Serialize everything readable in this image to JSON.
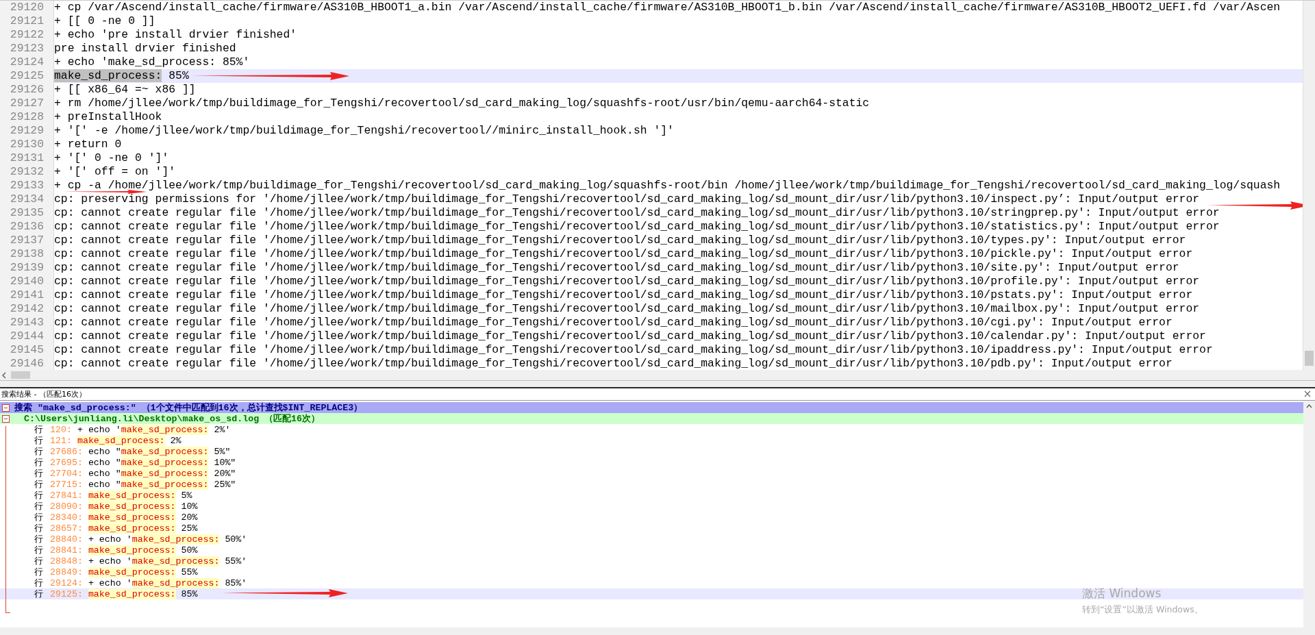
{
  "editor": {
    "lines": [
      {
        "number": "29120",
        "text": "+ cp /var/Ascend/install_cache/firmware/AS310B_HBOOT1_a.bin /var/Ascend/install_cache/firmware/AS310B_HBOOT1_b.bin /var/Ascend/install_cache/firmware/AS310B_HBOOT2_UEFI.fd /var/Ascen",
        "current": false
      },
      {
        "number": "29121",
        "text": "+ [[ 0 -ne 0 ]]",
        "current": false
      },
      {
        "number": "29122",
        "text": "+ echo 'pre install drvier finished'",
        "current": false
      },
      {
        "number": "29123",
        "text": "pre install drvier finished",
        "current": false
      },
      {
        "number": "29124",
        "text": "+ echo 'make_sd_process: 85%'",
        "current": false
      },
      {
        "number": "29125",
        "selection": "make_sd_process:",
        "text": " 85%",
        "current": true,
        "arrow_after": true
      },
      {
        "number": "29126",
        "text": "+ [[ x86_64 =~ x86 ]]",
        "current": false
      },
      {
        "number": "29127",
        "text": "+ rm /home/jllee/work/tmp/buildimage_for_Tengshi/recovertool/sd_card_making_log/squashfs-root/usr/bin/qemu-aarch64-static",
        "current": false
      },
      {
        "number": "29128",
        "text": "+ preInstallHook",
        "current": false
      },
      {
        "number": "29129",
        "text": "+ '[' -e /home/jllee/work/tmp/buildimage_for_Tengshi/recovertool//minirc_install_hook.sh ']'",
        "current": false
      },
      {
        "number": "29130",
        "text": "+ return 0",
        "current": false
      },
      {
        "number": "29131",
        "text": "+ '[' 0 -ne 0 ']'",
        "current": false
      },
      {
        "number": "29132",
        "text": "+ '[' off = on ']'",
        "current": false
      },
      {
        "number": "29133",
        "text": "+ cp -a /home/jllee/work/tmp/buildimage_for_Tengshi/recovertool/sd_card_making_log/squashfs-root/bin /home/jllee/work/tmp/buildimage_for_Tengshi/recovertool/sd_card_making_log/squash",
        "current": false,
        "arrow_under": true
      },
      {
        "number": "29134",
        "text": "cp: preserving permissions for '/home/jllee/work/tmp/buildimage_for_Tengshi/recovertool/sd_card_making_log/sd_mount_dir/usr/lib/python3.10/inspect.py’: Input/output error",
        "current": false,
        "arrow_after_low": true
      },
      {
        "number": "29135",
        "text": "cp: cannot create regular file '/home/jllee/work/tmp/buildimage_for_Tengshi/recovertool/sd_card_making_log/sd_mount_dir/usr/lib/python3.10/stringprep.py': Input/output error",
        "current": false
      },
      {
        "number": "29136",
        "text": "cp: cannot create regular file '/home/jllee/work/tmp/buildimage_for_Tengshi/recovertool/sd_card_making_log/sd_mount_dir/usr/lib/python3.10/statistics.py': Input/output error",
        "current": false
      },
      {
        "number": "29137",
        "text": "cp: cannot create regular file '/home/jllee/work/tmp/buildimage_for_Tengshi/recovertool/sd_card_making_log/sd_mount_dir/usr/lib/python3.10/types.py': Input/output error",
        "current": false
      },
      {
        "number": "29138",
        "text": "cp: cannot create regular file '/home/jllee/work/tmp/buildimage_for_Tengshi/recovertool/sd_card_making_log/sd_mount_dir/usr/lib/python3.10/pickle.py': Input/output error",
        "current": false
      },
      {
        "number": "29139",
        "text": "cp: cannot create regular file '/home/jllee/work/tmp/buildimage_for_Tengshi/recovertool/sd_card_making_log/sd_mount_dir/usr/lib/python3.10/site.py': Input/output error",
        "current": false
      },
      {
        "number": "29140",
        "text": "cp: cannot create regular file '/home/jllee/work/tmp/buildimage_for_Tengshi/recovertool/sd_card_making_log/sd_mount_dir/usr/lib/python3.10/profile.py': Input/output error",
        "current": false
      },
      {
        "number": "29141",
        "text": "cp: cannot create regular file '/home/jllee/work/tmp/buildimage_for_Tengshi/recovertool/sd_card_making_log/sd_mount_dir/usr/lib/python3.10/pstats.py': Input/output error",
        "current": false
      },
      {
        "number": "29142",
        "text": "cp: cannot create regular file '/home/jllee/work/tmp/buildimage_for_Tengshi/recovertool/sd_card_making_log/sd_mount_dir/usr/lib/python3.10/mailbox.py': Input/output error",
        "current": false
      },
      {
        "number": "29143",
        "text": "cp: cannot create regular file '/home/jllee/work/tmp/buildimage_for_Tengshi/recovertool/sd_card_making_log/sd_mount_dir/usr/lib/python3.10/cgi.py': Input/output error",
        "current": false
      },
      {
        "number": "29144",
        "text": "cp: cannot create regular file '/home/jllee/work/tmp/buildimage_for_Tengshi/recovertool/sd_card_making_log/sd_mount_dir/usr/lib/python3.10/calendar.py': Input/output error",
        "current": false
      },
      {
        "number": "29145",
        "text": "cp: cannot create regular file '/home/jllee/work/tmp/buildimage_for_Tengshi/recovertool/sd_card_making_log/sd_mount_dir/usr/lib/python3.10/ipaddress.py': Input/output error",
        "current": false
      },
      {
        "number": "29146",
        "text": "cp: cannot create regular file '/home/jllee/work/tmp/buildimage_for_Tengshi/recovertool/sd_card_making_log/sd_mount_dir/usr/lib/python3.10/pdb.py': Input/output error",
        "current": false
      }
    ]
  },
  "search_results": {
    "title": "搜索结果 - （匹配16次）",
    "query": {
      "text": "搜索 \"make_sd_process:\" （1个文件中匹配到16次，总计查找$INT_REPLACE3）",
      "expanded": true
    },
    "file": {
      "text": "C:\\Users\\junliang.li\\Desktop\\make_os_sd.log （匹配16次）",
      "expanded": true
    },
    "hits": [
      {
        "label": "行",
        "line": "120:",
        "before": "+ echo '",
        "match": "make_sd_process:",
        "after": " 2%'",
        "selected": false
      },
      {
        "label": "行",
        "line": "121:",
        "match": "make_sd_process:",
        "after": " 2%",
        "selected": false
      },
      {
        "label": "行",
        "line": "27686:",
        "before": "echo \"",
        "match": "make_sd_process:",
        "after": " 5%\"",
        "selected": false
      },
      {
        "label": "行",
        "line": "27695:",
        "before": "echo \"",
        "match": "make_sd_process:",
        "after": " 10%\"",
        "selected": false
      },
      {
        "label": "行",
        "line": "27704:",
        "before": "echo \"",
        "match": "make_sd_process:",
        "after": " 20%\"",
        "selected": false
      },
      {
        "label": "行",
        "line": "27715:",
        "before": "echo \"",
        "match": "make_sd_process:",
        "after": " 25%\"",
        "selected": false
      },
      {
        "label": "行",
        "line": "27841:",
        "match": "make_sd_process:",
        "after": " 5%",
        "selected": false
      },
      {
        "label": "行",
        "line": "28090:",
        "match": "make_sd_process:",
        "after": " 10%",
        "selected": false
      },
      {
        "label": "行",
        "line": "28340:",
        "match": "make_sd_process:",
        "after": " 20%",
        "selected": false
      },
      {
        "label": "行",
        "line": "28657:",
        "match": "make_sd_process:",
        "after": " 25%",
        "selected": false
      },
      {
        "label": "行",
        "line": "28840:",
        "before": "+ echo '",
        "match": "make_sd_process:",
        "after": " 50%'",
        "selected": false
      },
      {
        "label": "行",
        "line": "28841:",
        "match": "make_sd_process:",
        "after": " 50%",
        "selected": false
      },
      {
        "label": "行",
        "line": "28848:",
        "before": "+ echo '",
        "match": "make_sd_process:",
        "after": " 55%'",
        "selected": false
      },
      {
        "label": "行",
        "line": "28849:",
        "match": "make_sd_process:",
        "after": " 55%",
        "selected": false
      },
      {
        "label": "行",
        "line": "29124:",
        "before": "+ echo '",
        "match": "make_sd_process:",
        "after": " 85%'",
        "selected": false
      },
      {
        "label": "行",
        "line": "29125:",
        "match": "make_sd_process:",
        "after": " 85%",
        "selected": true,
        "arrow_after": true
      }
    ]
  },
  "activation_notice": {
    "title": "激活 Windows",
    "text": "转到“设置”以激活 Windows。"
  }
}
